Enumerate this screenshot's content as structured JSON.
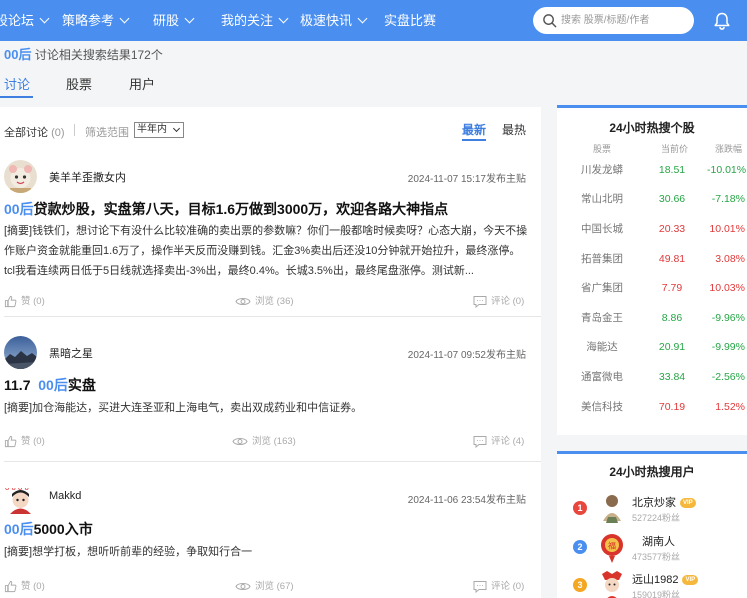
{
  "nav": {
    "items": [
      {
        "label": "股论坛",
        "chevron": true
      },
      {
        "label": "策略参考",
        "chevron": true
      },
      {
        "label": "研股",
        "chevron": true
      },
      {
        "label": "我的关注",
        "chevron": true
      },
      {
        "label": "极速快讯",
        "chevron": true
      },
      {
        "label": "实盘比赛",
        "chevron": false
      }
    ],
    "search_placeholder": "搜索 股票/标题/作者",
    "bell_icon": "bell-icon",
    "accent_color": "#4a8ff0"
  },
  "result": {
    "keyword": "00后",
    "text": "讨论相关搜索结果172个"
  },
  "tabs": [
    {
      "label": "讨论",
      "active": true
    },
    {
      "label": "股票",
      "active": false
    },
    {
      "label": "用户",
      "active": false
    }
  ],
  "filter": {
    "all_label": "全部讨论",
    "all_count": "(0)",
    "range_label": "筛选范围",
    "range_value": "半年内",
    "sort_new": "最新",
    "sort_hot": "最热"
  },
  "posts": [
    {
      "author": "美羊羊歪撒女内",
      "date": "2024-11-07 15:17发布主贴",
      "title_prefix": "",
      "title_keyword": "00后",
      "title_rest": "贷款炒股，实盘第八天，目标1.6万做到3000万，欢迎各路大神指点",
      "summary": "[摘要]钱铁们，想讨论下有没什么比较准确的卖出票的参数嘛？你们一般都啥时候卖呀？心态大崩，今天不操作账户资金就能重回1.6万了，操作半天反而没赚到钱。汇金3%卖出后还没10分钟就开始拉升，最终涨停。tcl我看连续两日低于5日线就选择卖出-3%出，最终0.4%。长城3.5%出，最终尾盘涨停。测试新...",
      "likes": "赞 (0)",
      "views": "浏览 (36)",
      "comments": "评论 (0)"
    },
    {
      "author": "黑暗之星",
      "date": "2024-11-07 09:52发布主贴",
      "title_prefix": "11.7  ",
      "title_keyword": "00后",
      "title_rest": "实盘",
      "summary": "[摘要]加仓海能达，买进大连圣亚和上海电气，卖出双成药业和中信证券。",
      "likes": "赞 (0)",
      "views": "浏览 (163)",
      "comments": "评论 (4)"
    },
    {
      "author": "Makkd",
      "date": "2024-11-06 23:54发布主贴",
      "title_prefix": "",
      "title_keyword": "00后",
      "title_rest": "5000入市",
      "summary": "[摘要]想学打板，想听听前辈的经验，争取知行合一",
      "likes": "赞 (0)",
      "views": "浏览 (67)",
      "comments": "评论 (0)"
    }
  ],
  "hot_stocks": {
    "title": "24小时热搜个股",
    "headers": [
      "股票",
      "当前价",
      "涨跌幅"
    ],
    "rows": [
      {
        "name": "川发龙蟒",
        "price": "18.51",
        "change": "-10.01%",
        "dir": "down"
      },
      {
        "name": "常山北明",
        "price": "30.66",
        "change": "-7.18%",
        "dir": "down"
      },
      {
        "name": "中国长城",
        "price": "20.33",
        "change": "10.01%",
        "dir": "up"
      },
      {
        "name": "拓普集团",
        "price": "49.81",
        "change": "3.08%",
        "dir": "up"
      },
      {
        "name": "省广集团",
        "price": "7.79",
        "change": "10.03%",
        "dir": "up"
      },
      {
        "name": "青岛金王",
        "price": "8.86",
        "change": "-9.96%",
        "dir": "down"
      },
      {
        "name": "海能达",
        "price": "20.91",
        "change": "-9.99%",
        "dir": "down"
      },
      {
        "name": "通富微电",
        "price": "33.84",
        "change": "-2.56%",
        "dir": "down"
      },
      {
        "name": "美信科技",
        "price": "70.19",
        "change": "1.52%",
        "dir": "up"
      }
    ],
    "up_color": "#e03a3a",
    "down_color": "#26a646"
  },
  "hot_users": {
    "title": "24小时热搜用户",
    "users": [
      {
        "rank": "1",
        "name": "北京炒家",
        "vip": "VIP",
        "fans": "527224粉丝",
        "rank_color": "#e8473e"
      },
      {
        "rank": "2",
        "name": "湖南人",
        "vip": "",
        "fans": "473577粉丝",
        "rank_color": "#4a8ff0"
      },
      {
        "rank": "3",
        "name": "远山1982",
        "vip": "VIP",
        "fans": "159019粉丝",
        "rank_color": "#f5a623"
      }
    ]
  }
}
